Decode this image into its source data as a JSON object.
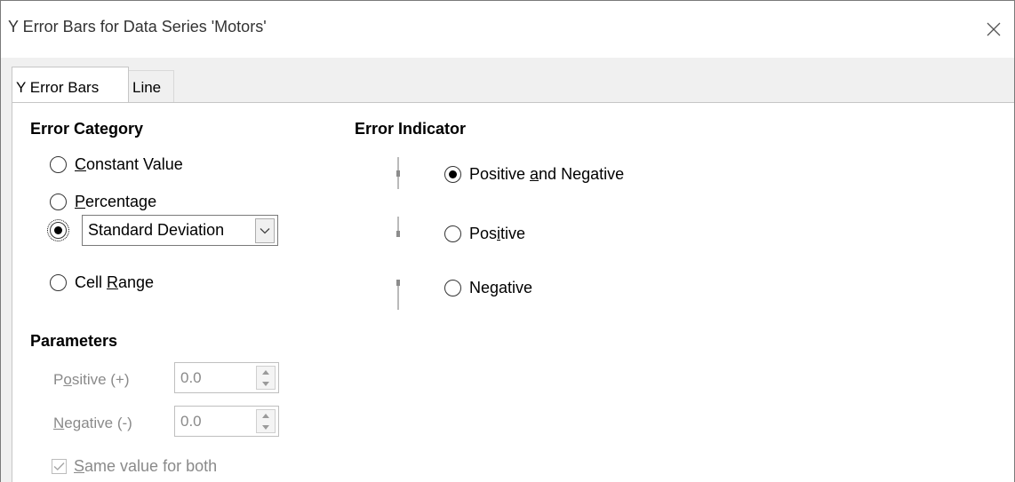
{
  "window": {
    "title": "Y Error Bars for Data Series 'Motors'"
  },
  "tabs": [
    {
      "label": "Y Error Bars",
      "active": true
    },
    {
      "label": "Line",
      "active": false
    }
  ],
  "error_category": {
    "title": "Error Category",
    "options": [
      {
        "label": "Constant Value",
        "mnemonic": "C",
        "checked": false
      },
      {
        "label": "Percentage",
        "mnemonic": "P",
        "checked": false
      },
      {
        "label": "Standard Deviation",
        "checked": true
      },
      {
        "label": "Cell Range",
        "mnemonic": "R",
        "checked": false
      }
    ],
    "function_select": {
      "selected": "Standard Deviation"
    }
  },
  "parameters": {
    "title": "Parameters",
    "positive_label": "Positive (+)",
    "positive_value": "0.0",
    "negative_label": "Negative (-)",
    "negative_value": "0.0",
    "same_value_label": "Same value for both",
    "same_value_checked": true,
    "enabled": false
  },
  "error_indicator": {
    "title": "Error Indicator",
    "options": [
      {
        "label": "Positive and Negative",
        "checked": true,
        "icon": "error-bar-both-icon"
      },
      {
        "label": "Positive",
        "checked": false,
        "icon": "error-bar-positive-icon"
      },
      {
        "label": "Negative",
        "checked": false,
        "icon": "error-bar-negative-icon"
      }
    ]
  },
  "colors": {
    "disabled_text": "#8a8a8a",
    "panel_bg": "#ffffff",
    "client_bg": "#f0f0f0"
  }
}
